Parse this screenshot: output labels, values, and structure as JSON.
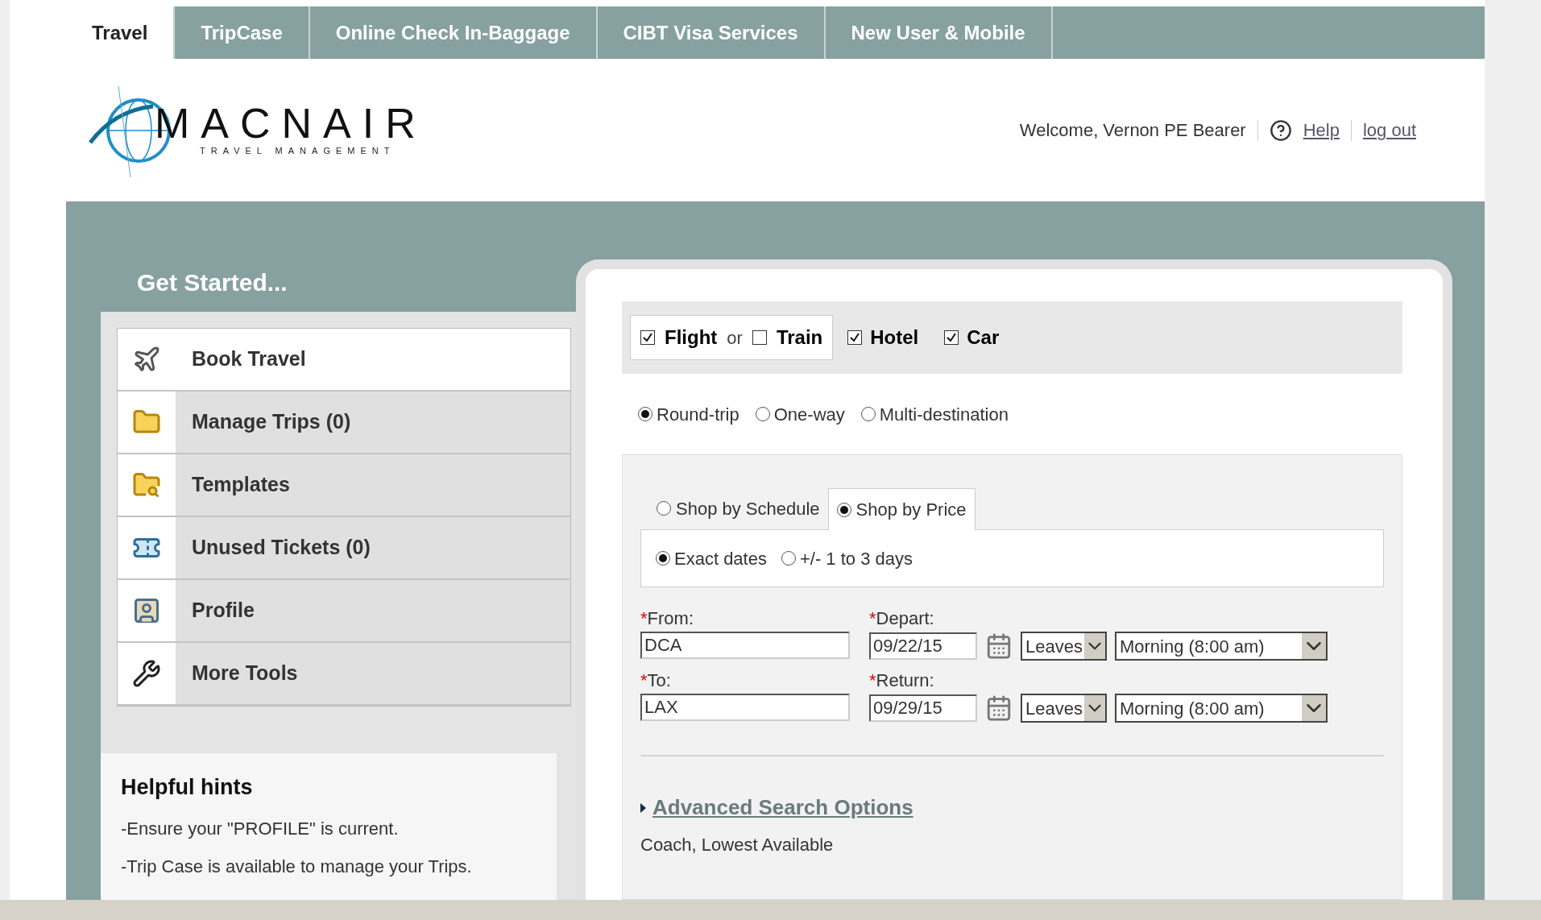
{
  "tabs": [
    {
      "label": "Travel",
      "selected": true
    },
    {
      "label": "TripCase",
      "selected": false
    },
    {
      "label": "Online Check In-Baggage",
      "selected": false
    },
    {
      "label": "CIBT Visa Services",
      "selected": false
    },
    {
      "label": "New User & Mobile",
      "selected": false
    }
  ],
  "logo": {
    "name": "MACNAIR",
    "tagline": "TRAVEL MANAGEMENT"
  },
  "header": {
    "welcome": "Welcome, Vernon PE Bearer",
    "help": "Help",
    "logout": "log out"
  },
  "section_title": "Get Started...",
  "menu": [
    {
      "label": "Book Travel",
      "kind": "plane",
      "selected": true
    },
    {
      "label": "Manage Trips (0)",
      "kind": "folder",
      "selected": false
    },
    {
      "label": "Templates",
      "kind": "search",
      "selected": false
    },
    {
      "label": "Unused Tickets (0)",
      "kind": "ticket",
      "selected": false
    },
    {
      "label": "Profile",
      "kind": "profile",
      "selected": false
    },
    {
      "label": "More Tools",
      "kind": "tools",
      "selected": false
    }
  ],
  "hints": {
    "title": "Helpful hints",
    "lines": [
      "-Ensure your \"PROFILE\" is current.",
      "-Trip Case is available to manage your Trips."
    ]
  },
  "modes": {
    "first": {
      "label": "Flight",
      "checked": true
    },
    "joiner": "or",
    "second": {
      "label": "Train",
      "checked": false
    }
  },
  "extras": [
    {
      "label": "Hotel",
      "checked": true
    },
    {
      "label": "Car",
      "checked": true
    }
  ],
  "trip_types": [
    {
      "label": "Round-trip",
      "selected": true
    },
    {
      "label": "One-way",
      "selected": false
    },
    {
      "label": "Multi-destination",
      "selected": false
    }
  ],
  "shop_tabs": [
    {
      "label": "Shop by Schedule",
      "selected": false
    },
    {
      "label": "Shop by Price",
      "selected": true
    }
  ],
  "date_options": [
    {
      "label": "Exact dates",
      "selected": true
    },
    {
      "label": "+/- 1 to 3 days",
      "selected": false
    }
  ],
  "rows": [
    {
      "place": {
        "mark": "*",
        "label": "From:",
        "value": "DCA"
      },
      "date": {
        "mark": "*",
        "label": "Depart:",
        "value": "09/22/15"
      },
      "leaves": "Leaves",
      "time": "Morning (8:00 am)"
    },
    {
      "place": {
        "mark": "*",
        "label": "To:",
        "value": "LAX"
      },
      "date": {
        "mark": "*",
        "label": "Return:",
        "value": "09/29/15"
      },
      "leaves": "Leaves",
      "time": "Morning (8:00 am)"
    }
  ],
  "advanced": {
    "link": "Advanced Search Options",
    "summary": "Coach, Lowest Available"
  }
}
